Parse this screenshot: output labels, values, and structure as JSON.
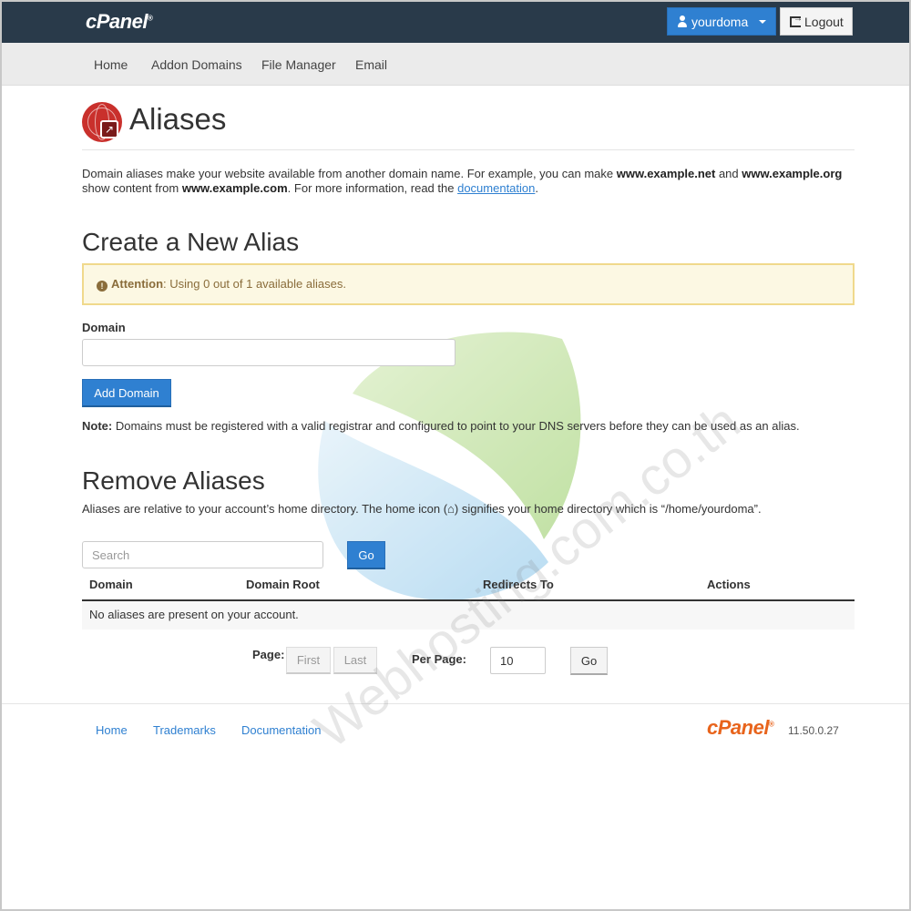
{
  "header": {
    "logo": "cPanel",
    "logo_mark": "®",
    "user_label": "yourdoma",
    "logout_label": "Logout"
  },
  "nav": {
    "items": [
      {
        "label": "Home"
      },
      {
        "label": "Addon Domains"
      },
      {
        "label": "File Manager"
      },
      {
        "label": "Email"
      }
    ]
  },
  "page": {
    "title": "Aliases",
    "desc_1": "Domain aliases make your website available from another domain name. For example, you can make ",
    "desc_b1": "www.example.net",
    "desc_2": " and ",
    "desc_b2": "www.example.org",
    "desc_3": " show content from ",
    "desc_b3": "www.example.com",
    "desc_4": ". For more information, read the ",
    "desc_link": "documentation",
    "desc_5": "."
  },
  "create": {
    "heading": "Create a New Alias",
    "alert_strong": "Attention",
    "alert_text": ": Using 0 out of 1 available aliases.",
    "domain_label": "Domain",
    "domain_value": "",
    "add_button": "Add Domain",
    "note_strong": "Note:",
    "note_text": " Domains must be registered with a valid registrar and configured to point to your DNS servers before they can be used as an alias."
  },
  "remove": {
    "heading": "Remove Aliases",
    "desc_1": "Aliases are relative to your account’s home directory. The home icon (",
    "desc_2": ") signifies your home directory which is “/home/yourdoma”.",
    "search_placeholder": "Search",
    "go_button": "Go",
    "columns": [
      "Domain",
      "Domain Root",
      "Redirects To",
      "Actions"
    ],
    "empty_message": "No aliases are present on your account.",
    "page_label": "Page:",
    "first_button": "First",
    "last_button": "Last",
    "per_page_label": "Per Page:",
    "per_page_value": "10",
    "per_page_go": "Go"
  },
  "footer": {
    "links": [
      {
        "label": "Home"
      },
      {
        "label": "Trademarks"
      },
      {
        "label": "Documentation"
      }
    ],
    "logo": "cPanel",
    "logo_mark": "®",
    "version": "11.50.0.27"
  },
  "watermark": {
    "text": "Webhosting.com.co.th"
  },
  "colors": {
    "topbar": "#293a4a",
    "primary": "#2f80d1",
    "alert_bg": "#fcf8e3",
    "alert_border": "#f0d98c",
    "footer_logo": "#e8641c"
  }
}
